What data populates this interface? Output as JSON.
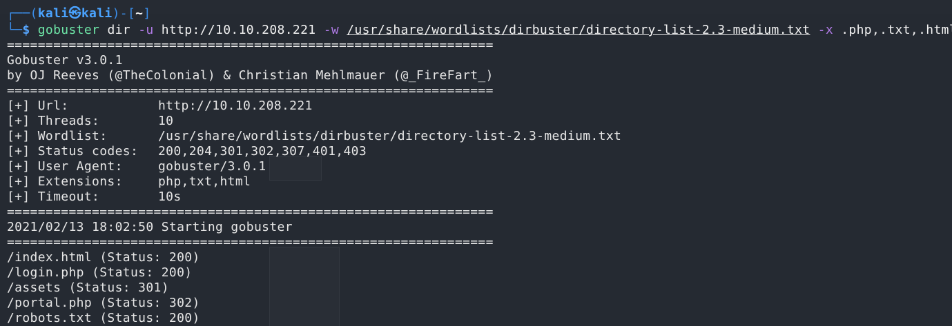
{
  "prompt": {
    "user": "kali",
    "host": "kali",
    "cwd": "~",
    "symbol": "$"
  },
  "command": {
    "tool": "gobuster",
    "mode": "dir",
    "flag_u": "-u",
    "url": "http://10.10.208.221",
    "flag_w": "-w",
    "wordlist": "/usr/share/wordlists/dirbuster/directory-list-2.3-medium.txt",
    "flag_x": "-x",
    "extensions": ".php,.txt,.html"
  },
  "separator": "===============================================================",
  "banner": {
    "version": "Gobuster v3.0.1",
    "authors": "by OJ Reeves (@TheColonial) & Christian Mehlmauer (@_FireFart_)"
  },
  "config": [
    {
      "label": "[+] Url:",
      "value": "http://10.10.208.221"
    },
    {
      "label": "[+] Threads:",
      "value": "10"
    },
    {
      "label": "[+] Wordlist:",
      "value": "/usr/share/wordlists/dirbuster/directory-list-2.3-medium.txt"
    },
    {
      "label": "[+] Status codes:",
      "value": "200,204,301,302,307,401,403"
    },
    {
      "label": "[+] User Agent:",
      "value": "gobuster/3.0.1"
    },
    {
      "label": "[+] Extensions:",
      "value": "php,txt,html"
    },
    {
      "label": "[+] Timeout:",
      "value": "10s"
    }
  ],
  "start_message": "2021/02/13 18:02:50 Starting gobuster",
  "results": [
    "/index.html (Status: 200)",
    "/login.php (Status: 200)",
    "/assets (Status: 301)",
    "/portal.php (Status: 302)",
    "/robots.txt (Status: 200)"
  ],
  "colors": {
    "background": "#252a32",
    "prompt_frame": "#3b8eea",
    "prompt_user": "#4aa3ff",
    "flags": "#b07be6",
    "tool": "#6ee7a8",
    "text": "#e6e6e6"
  }
}
